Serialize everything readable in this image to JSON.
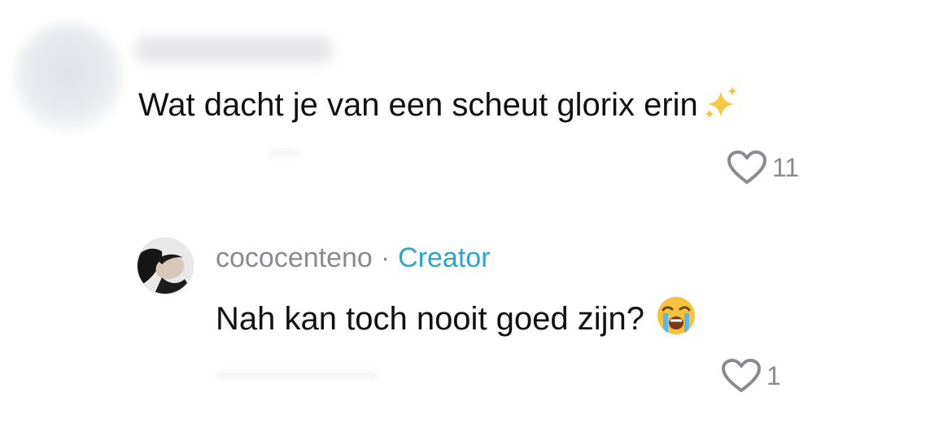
{
  "comments": [
    {
      "author": "",
      "text": "Wat dacht je van een scheut glorix erin",
      "emoji": "sparkles-emoji",
      "likes": "11"
    }
  ],
  "reply": {
    "author": "cococenteno",
    "separator": "·",
    "badge": "Creator",
    "text": "Nah kan toch nooit goed zijn?",
    "emoji": "loudly-crying-face-emoji",
    "likes": "1"
  },
  "colors": {
    "text": "#111111",
    "muted": "#8a8b91",
    "creator": "#2aa6c8",
    "heart_outline": "#8a8b91",
    "background": "#ffffff"
  },
  "icons": {
    "like": "heart-outline-icon"
  }
}
